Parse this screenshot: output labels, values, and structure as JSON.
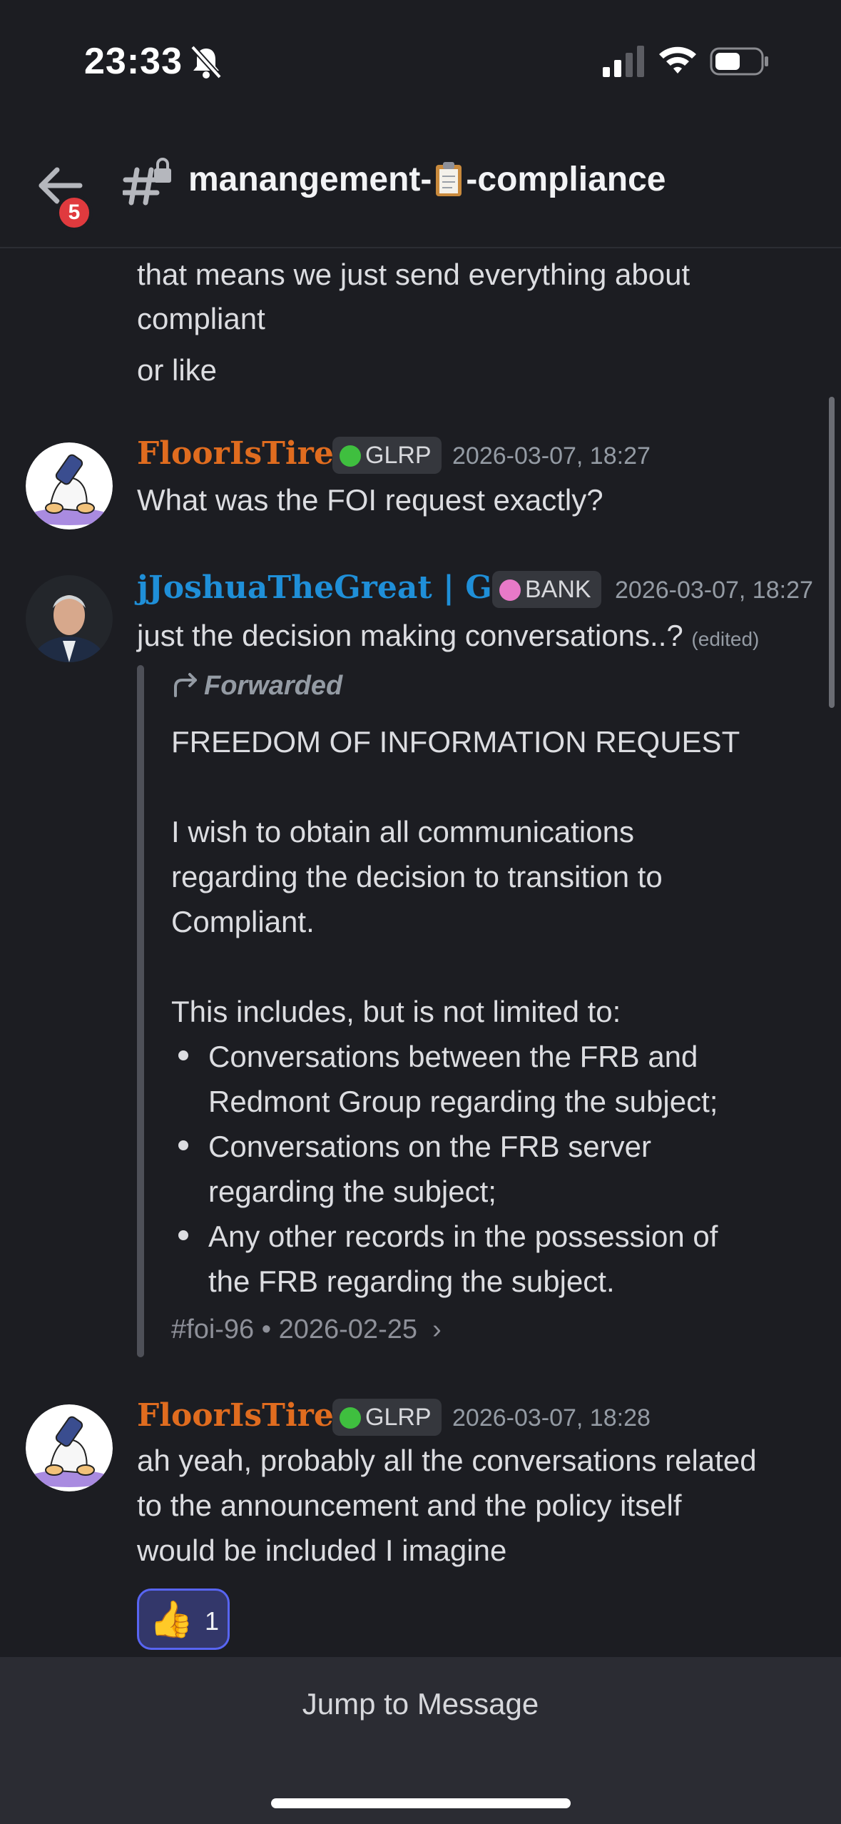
{
  "status_bar": {
    "time": "23:33"
  },
  "header": {
    "badge_count": "5",
    "channel_prefix": "manangement-",
    "channel_suffix": "-compliance"
  },
  "messages": {
    "prev_line1": "that means we just send everything about",
    "prev_line2": "compliant",
    "prev_line3": "or like",
    "m1": {
      "author": "FloorIsTired",
      "author_color": "#e06c1f",
      "role": "GLRP",
      "timestamp": "2026-03-07, 18:27",
      "text": "What was the FOI request exactly?"
    },
    "m2": {
      "author": "jJoshuaTheGreat | G...",
      "author_color": "#1f8fd8",
      "role": "BANK",
      "timestamp": "2026-03-07, 18:27",
      "text": "just the decision making conversations..?",
      "edited": "(edited)",
      "forward": {
        "label": "Forwarded",
        "heading": "FREEDOM OF INFORMATION REQUEST",
        "para1_l1": "I wish to obtain all communications",
        "para1_l2": "regarding the decision to transition to",
        "para1_l3": "Compliant.",
        "intro": "This includes, but is not limited to:",
        "b1_l1": "Conversations between the FRB and",
        "b1_l2": "Redmont Group regarding the subject;",
        "b2_l1": "Conversations on the FRB server",
        "b2_l2": "regarding the subject;",
        "b3_l1": "Any other records in the possession of",
        "b3_l2": "the FRB regarding the subject.",
        "source": "#foi-96 • 2026-02-25",
        "chevron": "›"
      }
    },
    "m3": {
      "author": "FloorIsTired",
      "role": "GLRP",
      "timestamp": "2026-03-07, 18:28",
      "line1": "ah yeah, probably all the conversations related",
      "line2": "to the announcement and the policy itself",
      "line3": "would be included I imagine",
      "reaction_emoji": "👍",
      "reaction_count": "1"
    }
  },
  "footer": {
    "jump_label": "Jump to Message"
  }
}
